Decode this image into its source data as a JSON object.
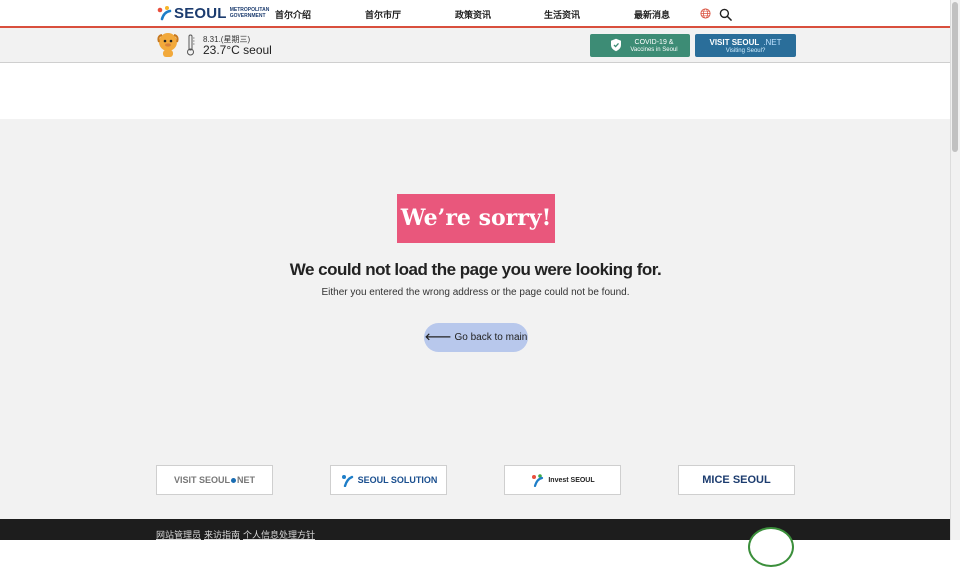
{
  "header": {
    "logo_word": "SEOUL",
    "logo_sub_1": "METROPOLITAN",
    "logo_sub_2": "GOVERNMENT",
    "nav": [
      "首尔介绍",
      "首尔市厅",
      "政策资讯",
      "生活资讯",
      "最新消息"
    ],
    "icons": [
      "globe-icon",
      "search-icon"
    ]
  },
  "weather": {
    "date": "8.31.(星期三)",
    "temp": "23.7°C seoul"
  },
  "quick_links": {
    "covid_line1": "COVID-19 &",
    "covid_line2": "Vaccines in Seoul",
    "visit_line1": "VISIT SEOUL",
    "visit_net": ".NET",
    "visit_line2": "Visiting Seoul?"
  },
  "error": {
    "badge": "We’re sorry!",
    "title": "We could not load the page you were looking for.",
    "description": "Either you entered the wrong address or the page could not be found.",
    "back_label": "Go back to main"
  },
  "partners": {
    "visit_a": "VISIT SEOUL",
    "visit_b": "NET",
    "solution": "SEOUL SOLUTION",
    "invest": "Invest SEOUL",
    "mice": "MICE SEOUL"
  },
  "footer": {
    "links": [
      "网站管理员",
      "来访指南",
      "个人信息处理方针"
    ]
  },
  "colors": {
    "accent_red": "#d94f3d",
    "sorry_pink": "#e9577c",
    "back_button": "#b8c8ec",
    "covid_green": "#3d8c75",
    "visit_blue": "#2a6e9a",
    "footer_bg": "#1d1d1d"
  }
}
